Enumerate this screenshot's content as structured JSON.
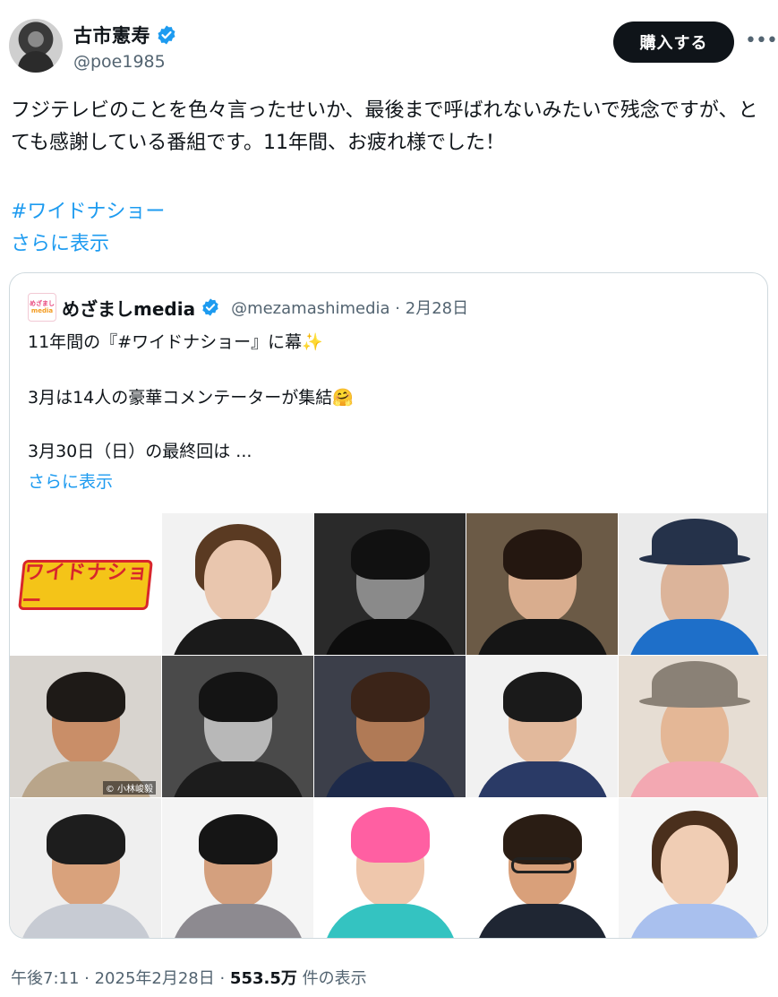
{
  "author": {
    "display_name": "古市憲寿",
    "handle": "@poe1985"
  },
  "actions": {
    "buy_label": "購入する",
    "more_icon": "more-horizontal-icon"
  },
  "tweet": {
    "text": "フジテレビのことを色々言ったせいか、最後まで呼ばれないみたいで残念ですが、とても感謝している番組です。11年間、お疲れ様でした！",
    "hashtag": "#ワイドナショー",
    "show_more": "さらに表示"
  },
  "quote": {
    "logo_text_1": "めざまし",
    "logo_text_2": "media",
    "name": "めざましmedia",
    "handle_date": "@mezamashimedia · 2月28日",
    "line1": "11年間の『#ワイドナショー』に幕✨",
    "line2": "3月は14人の豪華コメンテーターが集結🤗",
    "line3": "3月30日（日）の最終回は ...",
    "show_more": "さらに表示",
    "show_logo_text": "ワイドナショー",
    "photo_credit": "© 小林峻毅"
  },
  "colors": {
    "link": "#1d9bf0",
    "verified": "#1d9bf0",
    "secondary_text": "#536471",
    "button_bg": "#0f1419"
  },
  "footer": {
    "time_date": "午後7:11 · 2025年2月28日 · ",
    "views": "553.5万",
    "views_suffix": " 件の表示"
  }
}
